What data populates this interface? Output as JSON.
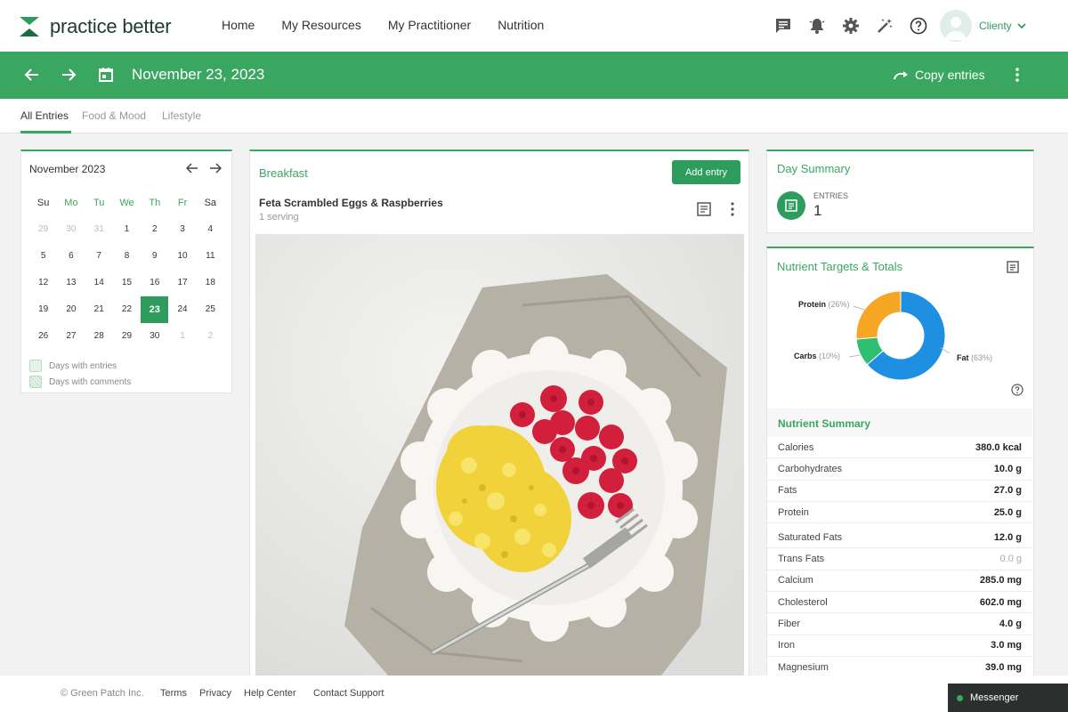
{
  "brand": {
    "name": "practice better"
  },
  "nav": {
    "links": [
      "Home",
      "My Resources",
      "My Practitioner",
      "Nutrition"
    ],
    "user": "Clienty"
  },
  "datebar": {
    "date": "November 23, 2023",
    "copy_label": "Copy entries"
  },
  "tabs": [
    "All Entries",
    "Food & Mood",
    "Lifestyle"
  ],
  "calendar": {
    "month_label": "November 2023",
    "weekdays": [
      "Su",
      "Mo",
      "Tu",
      "We",
      "Th",
      "Fr",
      "Sa"
    ],
    "weeks": [
      [
        "29",
        "30",
        "31",
        "1",
        "2",
        "3",
        "4"
      ],
      [
        "5",
        "6",
        "7",
        "8",
        "9",
        "10",
        "11"
      ],
      [
        "12",
        "13",
        "14",
        "15",
        "16",
        "17",
        "18"
      ],
      [
        "19",
        "20",
        "21",
        "22",
        "23",
        "24",
        "25"
      ],
      [
        "26",
        "27",
        "28",
        "29",
        "30",
        "1",
        "2"
      ]
    ],
    "selected_day": "23",
    "legend_entries": "Days with entries",
    "legend_comments": "Days with comments"
  },
  "meal": {
    "title": "Breakfast",
    "add_label": "Add entry",
    "food_name": "Feta Scrambled Eggs & Raspberries",
    "serving": "1 serving"
  },
  "day_summary": {
    "title": "Day Summary",
    "entries_label": "ENTRIES",
    "entries_count": "1"
  },
  "nutrients": {
    "title": "Nutrient Targets & Totals",
    "breakdown": [
      {
        "name": "Protein",
        "pct_label": "(26%)",
        "value": 26,
        "color": "#f5a623"
      },
      {
        "name": "Carbs",
        "pct_label": "(10%)",
        "value": 10,
        "color": "#2fbf71"
      },
      {
        "name": "Fat",
        "pct_label": "(63%)",
        "value": 63,
        "color": "#1e8fe1"
      }
    ],
    "summary_title": "Nutrient Summary",
    "rows": [
      {
        "name": "Calories",
        "value": "380.0 kcal"
      },
      {
        "name": "Carbohydrates",
        "value": "10.0 g"
      },
      {
        "name": "Fats",
        "value": "27.0 g"
      },
      {
        "name": "Protein",
        "value": "25.0 g"
      },
      {
        "name": "Saturated Fats",
        "value": "12.0 g"
      },
      {
        "name": "Trans Fats",
        "value": "0.0 g"
      },
      {
        "name": "Calcium",
        "value": "285.0 mg"
      },
      {
        "name": "Cholesterol",
        "value": "602.0 mg"
      },
      {
        "name": "Fiber",
        "value": "4.0 g"
      },
      {
        "name": "Iron",
        "value": "3.0 mg"
      },
      {
        "name": "Magnesium",
        "value": "39.0 mg"
      }
    ]
  },
  "footer": {
    "copyright": "© Green Patch Inc.",
    "links": [
      "Terms",
      "Privacy",
      "Help Center",
      "Contact Support"
    ]
  },
  "messenger": {
    "label": "Messenger"
  },
  "colors": {
    "brand_green": "#3aa760",
    "dark_green": "#2e9c5d"
  }
}
